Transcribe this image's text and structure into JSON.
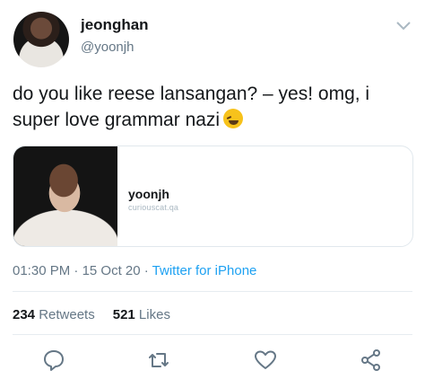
{
  "user": {
    "display_name": "jeonghan",
    "handle": "@yoonjh"
  },
  "tweet": {
    "text": "do you like reese lansangan? – yes! omg, i super love grammar nazi",
    "emoji_icon": "winking-face-with-tongue-emoji"
  },
  "card": {
    "title": "yoonjh",
    "domain": "curiouscat.qa"
  },
  "meta": {
    "time": "01:30 PM",
    "sep1": " · ",
    "date": "15 Oct 20",
    "sep2": " · ",
    "via": "Twitter for iPhone"
  },
  "stats": {
    "retweets_count": "234",
    "retweets_label": " Retweets",
    "likes_count": "521",
    "likes_label": " Likes"
  },
  "actions": [
    "reply-icon",
    "retweet-icon",
    "like-icon",
    "share-icon"
  ],
  "colors": {
    "link": "#1da1f2",
    "secondary_text": "#657786",
    "icon": "#657786",
    "divider": "#e6ecf0"
  }
}
